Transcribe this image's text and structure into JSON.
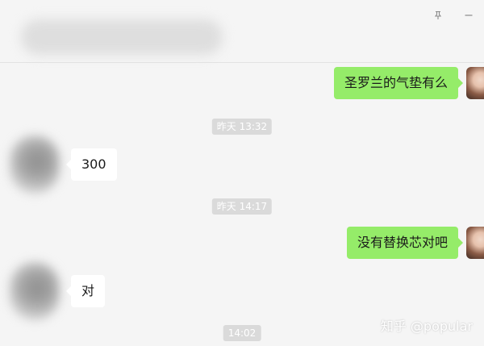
{
  "window": {
    "pin_icon": "pin-icon",
    "minimize_icon": "minimize-icon"
  },
  "messages": [
    {
      "side": "right",
      "text": "圣罗兰的气垫有么"
    },
    {
      "type": "time",
      "text": "昨天 13:32"
    },
    {
      "side": "left",
      "text": "300"
    },
    {
      "type": "time",
      "text": "昨天 14:17"
    },
    {
      "side": "right",
      "text": "没有替换芯对吧"
    },
    {
      "side": "left",
      "text": "对"
    },
    {
      "type": "time",
      "text": "14:02"
    }
  ],
  "watermark": "知乎 @popular",
  "colors": {
    "sent_bubble": "#95ec69",
    "received_bubble": "#ffffff",
    "background": "#f5f5f5",
    "timestamp_bg": "#dadada"
  }
}
